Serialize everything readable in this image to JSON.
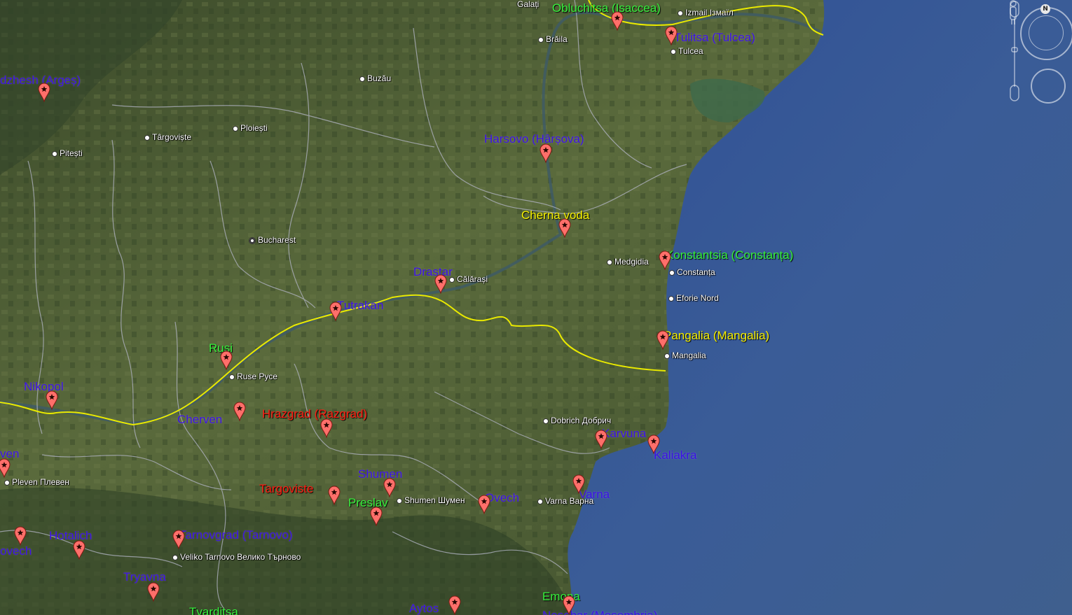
{
  "navigation": {
    "north_label": "N",
    "icons": [
      "compass-ring-icon",
      "look-joystick-icon",
      "pegman-icon",
      "zoom-slider-icon"
    ]
  },
  "colors": {
    "water": "#3a5c97",
    "land": "#4b5f34",
    "border_yellow": "#e9e900",
    "admin_border": "#b0b3c0",
    "pin": "#ff6f6a",
    "label_purple": "#3b10e6",
    "label_yellow": "#f6f000",
    "label_green": "#36f03c",
    "label_red": "#ff1c12"
  },
  "placemarks": [
    {
      "name": "Obluchitsa (Isaccea)",
      "color": "green"
    },
    {
      "name": "Tulitsa (Tulcea)",
      "color": "purple"
    },
    {
      "name": "dzhesh (Argeș)",
      "color": "purple"
    },
    {
      "name": "Harsovo (Hârșova)",
      "color": "purple"
    },
    {
      "name": "Cherna voda",
      "color": "yellow"
    },
    {
      "name": "Konstantsia (Constanța)",
      "color": "green"
    },
    {
      "name": "Drastar",
      "color": "purple"
    },
    {
      "name": "Tutrakan",
      "color": "purple"
    },
    {
      "name": "Pangalia (Mangalia)",
      "color": "yellow"
    },
    {
      "name": "Rusi",
      "color": "green"
    },
    {
      "name": "Nikopol",
      "color": "purple"
    },
    {
      "name": "Cherven",
      "color": "purple"
    },
    {
      "name": "Hrazgrad (Razgrad)",
      "color": "red"
    },
    {
      "name": "Karvuna",
      "color": "purple"
    },
    {
      "name": "Kaliakra",
      "color": "purple"
    },
    {
      "name": "ven",
      "color": "purple"
    },
    {
      "name": "Shumen",
      "color": "purple"
    },
    {
      "name": "Targoviste",
      "color": "red"
    },
    {
      "name": "Preslav",
      "color": "green"
    },
    {
      "name": "Ovech",
      "color": "purple"
    },
    {
      "name": "Varna",
      "color": "purple"
    },
    {
      "name": "Hotalich",
      "color": "purple"
    },
    {
      "name": "ovech",
      "color": "purple"
    },
    {
      "name": "Tarnovgrad (Tarnovo)",
      "color": "purple"
    },
    {
      "name": "Tryavna",
      "color": "purple"
    },
    {
      "name": "Aytos",
      "color": "purple"
    },
    {
      "name": "Emona",
      "color": "green"
    },
    {
      "name": "Tvarditsa",
      "color": "green"
    },
    {
      "name": "Nesebar (Mesembria)",
      "color": "purple"
    }
  ],
  "cities": [
    {
      "name": "Galați"
    },
    {
      "name": "Izmail Ізмаїл"
    },
    {
      "name": "Brăila"
    },
    {
      "name": "Tulcea"
    },
    {
      "name": "Buzău"
    },
    {
      "name": "Târgoviște"
    },
    {
      "name": "Ploiești"
    },
    {
      "name": "Pitești"
    },
    {
      "name": "Bucharest",
      "capital": true
    },
    {
      "name": "Călărași"
    },
    {
      "name": "Medgidia"
    },
    {
      "name": "Constanța"
    },
    {
      "name": "Eforie Nord"
    },
    {
      "name": "Mangalia"
    },
    {
      "name": "Ruse Русе"
    },
    {
      "name": "Dobrich Добрич"
    },
    {
      "name": "Pleven Плевен"
    },
    {
      "name": "Shumen Шумен"
    },
    {
      "name": "Varna Варна"
    },
    {
      "name": "Veliko Tarnovo Велико Търново"
    }
  ]
}
